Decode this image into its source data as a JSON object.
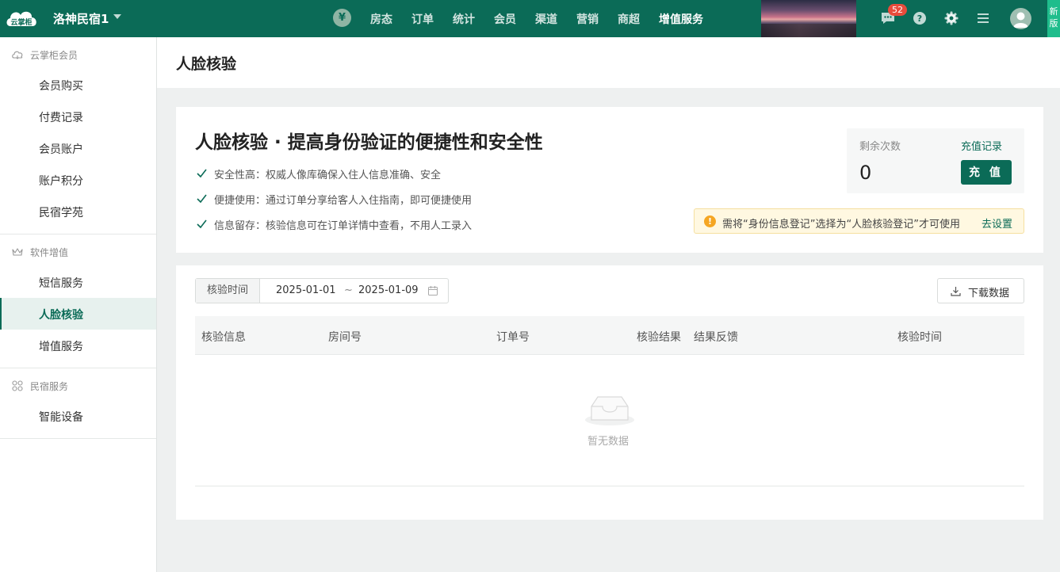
{
  "topbar": {
    "logo_text": "云掌柜",
    "hotel_name": "洛神民宿1",
    "yen_symbol": "¥",
    "nav": [
      "房态",
      "订单",
      "统计",
      "会员",
      "渠道",
      "营销",
      "商超",
      "增值服务"
    ],
    "active_nav": "增值服务",
    "message_count": "52",
    "new_version_label": "新版",
    "icons": [
      "message-icon",
      "help-icon",
      "settings-icon",
      "menu-icon",
      "user-avatar-icon"
    ],
    "colors": {
      "bar": "#0b6b57",
      "accent": "#1fbd8c",
      "badge": "#e74c3c"
    }
  },
  "sidebar": {
    "groups": [
      {
        "title": "云掌柜会员",
        "icon": "cloud-icon",
        "items": [
          "会员购买",
          "付费记录",
          "会员账户",
          "账户积分",
          "民宿学苑"
        ]
      },
      {
        "title": "软件增值",
        "icon": "crown-icon",
        "items": [
          "短信服务",
          "人脸核验",
          "增值服务"
        ]
      },
      {
        "title": "民宿服务",
        "icon": "grid-icon",
        "items": [
          "智能设备"
        ]
      }
    ],
    "active_item": "人脸核验"
  },
  "page": {
    "title": "人脸核验"
  },
  "intro": {
    "title": "人脸核验 · 提高身份验证的便捷性和安全性",
    "features": [
      "安全性高：权威人像库确保入住人信息准确、安全",
      "便捷使用：通过订单分享给客人入住指南，即可便捷使用",
      "信息留存：核验信息可在订单详情中查看，不用人工录入"
    ],
    "balance": {
      "label": "剩余次数",
      "value": "0",
      "records_link": "充值记录",
      "recharge_button": "充 值"
    },
    "notice": {
      "text": "需将“身份信息登记”选择为“人脸核验登记”才可使用",
      "link": "去设置",
      "icon": "!"
    }
  },
  "records": {
    "filter": {
      "label": "核验时间",
      "start": "2025-01-01",
      "separator": "~",
      "end": "2025-01-09"
    },
    "download_button": "下载数据",
    "columns": [
      "核验信息",
      "房间号",
      "订单号",
      "核验结果",
      "结果反馈",
      "核验时间"
    ],
    "rows": [],
    "empty_text": "暂无数据"
  }
}
